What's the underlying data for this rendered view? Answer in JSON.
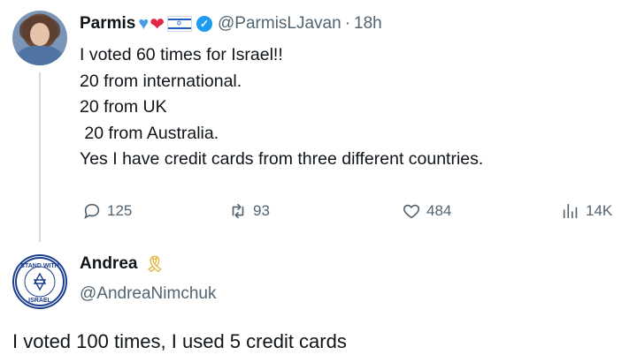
{
  "tweet": {
    "author_name": "Parmis",
    "handle": "@ParmisLJavan",
    "separator": "·",
    "time": "18h",
    "lines": [
      "I voted 60 times for Israel!!",
      "20 from international.",
      "20 from UK",
      " 20 from Australia.",
      "Yes I have credit cards from three different countries."
    ],
    "actions": {
      "replies": "125",
      "reposts": "93",
      "likes": "484",
      "views": "14K"
    }
  },
  "reply": {
    "author_name": "Andrea",
    "handle": "@AndreaNimchuk",
    "text": "I voted 100 times, I used 5 credit cards",
    "avatar_badge_text": "I STAND WITH ISRAEL"
  },
  "colors": {
    "text_primary": "#0f1419",
    "text_secondary": "#536471",
    "verified_blue": "#1d9bf0"
  },
  "icons": [
    "blue-heart-icon",
    "red-heart-icon",
    "israel-flag-icon",
    "verified-badge-icon",
    "reply-icon",
    "retweet-icon",
    "like-icon",
    "views-icon",
    "ribbon-icon"
  ]
}
